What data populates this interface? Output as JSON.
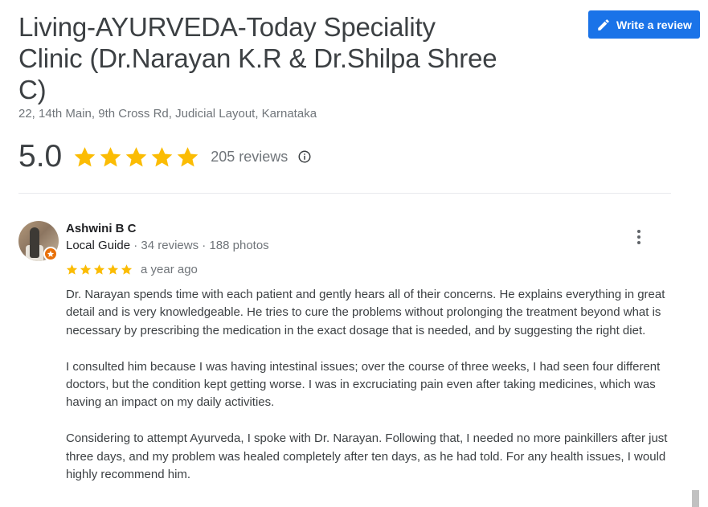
{
  "place": {
    "title": "Living-AYURVEDA-Today Speciality Clinic (Dr.Narayan K.R & Dr.Shilpa Shree C)",
    "address": "22, 14th Main, 9th Cross Rd, Judicial Layout, Karnataka"
  },
  "actions": {
    "write_review_label": "Write a review",
    "write_review_icon": "pencil-icon"
  },
  "summary": {
    "rating": "5.0",
    "stars": 5,
    "review_count": "205 reviews",
    "info_icon": "info-icon"
  },
  "colors": {
    "accent": "#1a73e8",
    "star": "#fbbc04",
    "local_guide_badge": "#e8710a"
  },
  "review": {
    "author": "Ashwini B C",
    "guide_label": "Local Guide",
    "reviews": "34 reviews",
    "photos": "188 photos",
    "separator": "·",
    "stars": 5,
    "time": "a year ago",
    "paragraphs": [
      "Dr. Narayan spends time with each patient and gently hears all of their concerns. He explains everything in great detail and is very knowledgeable. He tries to cure the problems without prolonging the treatment beyond what is necessary by prescribing the medication in the exact dosage that is needed, and by suggesting the right diet.",
      "I consulted him because I was having intestinal issues; over the course of three weeks, I had seen four different doctors, but the condition kept getting worse. I was in excruciating pain even after taking medicines, which was having an impact on my daily activities.",
      "Considering to attempt Ayurveda, I spoke with Dr. Narayan. Following that, I needed no more painkillers after just three days, and my problem was healed completely after ten days, as he had told. For any health issues, I would highly recommend him."
    ],
    "more_icon": "more-vert-icon"
  }
}
